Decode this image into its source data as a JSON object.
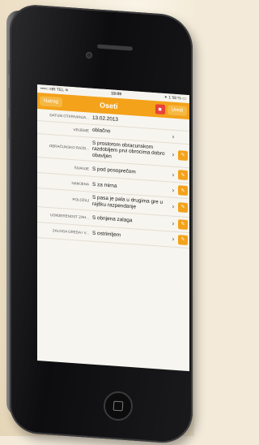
{
  "status_bar": {
    "carrier": "••••○ HR TEL ≋",
    "time": "19:09",
    "battery": "✦ 1 58 % ▭"
  },
  "nav": {
    "back_label": "Natrag",
    "title": "Oseti",
    "delete_icon": "trash-icon",
    "edit_label": "Uredi"
  },
  "rows": [
    {
      "label": "DATUM OTKRIVANJA...",
      "value": "13.02.2013",
      "chevron": false,
      "edit": false
    },
    {
      "label": "VRIJEME",
      "value": "oblačno",
      "chevron": true,
      "edit": false
    },
    {
      "label": "OBRAČUNSKO RAZD...",
      "value": "S prostorom obracunskom razdobljem prvi obrocima dobro obavljen",
      "chevron": true,
      "edit": true
    },
    {
      "label": "ŠIVANJE",
      "value": "S pod posoprečom",
      "chevron": true,
      "edit": true
    },
    {
      "label": "NAMJENA",
      "value": "S za mirna",
      "chevron": true,
      "edit": true
    },
    {
      "label": "POLOŽAJ",
      "value": "S pasa je pala u drugima gre u rajšku razpendanje",
      "chevron": true,
      "edit": true
    },
    {
      "label": "USMJERENOST ZAH...",
      "value": "S obnjena zalaga",
      "chevron": true,
      "edit": true
    },
    {
      "label": "ZALOGA GREDA I V...",
      "value": "S ostrimljem",
      "chevron": true,
      "edit": true
    }
  ]
}
